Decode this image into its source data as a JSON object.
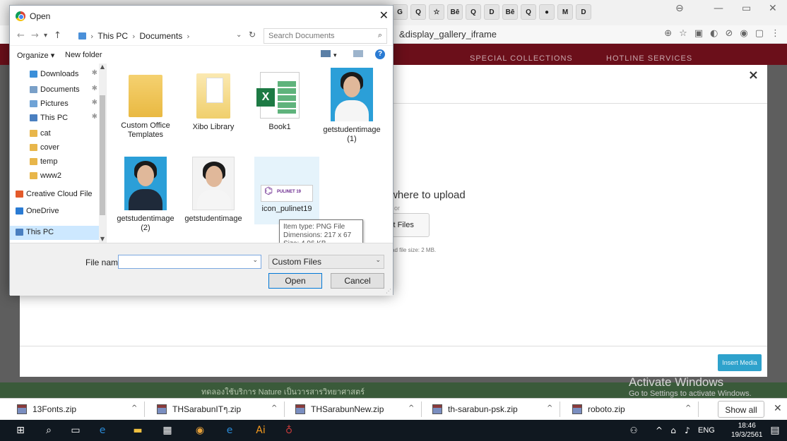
{
  "browser": {
    "address_text": "&display_gallery_iframe",
    "tabs": [
      "G",
      "Q",
      "☆",
      "Bē",
      "Q",
      "D",
      "Bē",
      "Q",
      "●",
      "M",
      "D"
    ],
    "site_nav": [
      "SPECIAL COLLECTIONS",
      "HOTLINE SERVICES"
    ]
  },
  "background_page": {
    "upload_title": "where to upload",
    "or_text": "or",
    "select_files_label": "ct Files",
    "max_size_text": "ad file size: 2 MB.",
    "insert_media_label": "Insert Media",
    "watermark_title": "Activate Windows",
    "watermark_sub": "Go to Settings to activate Windows.",
    "strip_text": "ทดลองใช้บริการ Nature เป็นวารสารวิทยาศาสตร์"
  },
  "dialog": {
    "title": "Open",
    "breadcrumb": [
      "This PC",
      "Documents"
    ],
    "search_placeholder": "Search Documents",
    "organize_label": "Organize ▾",
    "new_folder_label": "New folder",
    "sidebar": [
      {
        "label": "Downloads",
        "pinned": true,
        "color": "#3b8fd9"
      },
      {
        "label": "Documents",
        "pinned": true,
        "color": "#7aa0c8"
      },
      {
        "label": "Pictures",
        "pinned": true,
        "color": "#6fa3d6"
      },
      {
        "label": "This PC",
        "pinned": true,
        "color": "#4a7fc0"
      },
      {
        "label": "cat",
        "pinned": false,
        "color": "#e8b64a"
      },
      {
        "label": "cover",
        "pinned": false,
        "color": "#e8b64a"
      },
      {
        "label": "temp",
        "pinned": false,
        "color": "#e8b64a"
      },
      {
        "label": "www2",
        "pinned": false,
        "color": "#e8b64a"
      },
      {
        "label": "Creative Cloud File",
        "pinned": false,
        "color": "#e35a2a"
      },
      {
        "label": "OneDrive",
        "pinned": false,
        "color": "#2a7bd3"
      },
      {
        "label": "This PC",
        "pinned": false,
        "color": "#4a7fc0"
      }
    ],
    "files": [
      {
        "name": "Custom Office Templates",
        "kind": "folder"
      },
      {
        "name": "Xibo Library",
        "kind": "folder-lib"
      },
      {
        "name": "Book1",
        "kind": "excel"
      },
      {
        "name": "getstudentimage (1)",
        "kind": "photo-female"
      },
      {
        "name": "getstudentimage (2)",
        "kind": "photo-male"
      },
      {
        "name": "getstudentimage",
        "kind": "photo-female-light"
      },
      {
        "name": "icon_pulinet19",
        "kind": "logo"
      }
    ],
    "logo_thumb_text": "PULINET 19",
    "tooltip": {
      "type": "Item type: PNG File",
      "dimensions": "Dimensions: 217 x 67",
      "size": "Size: 4.96 KB"
    },
    "file_name_label": "File name:",
    "file_name_value": "",
    "filter_value": "Custom Files",
    "open_label": "Open",
    "cancel_label": "Cancel"
  },
  "downloads": [
    {
      "name": "13Fonts.zip"
    },
    {
      "name": "THSarabunITๆ.zip"
    },
    {
      "name": "THSarabunNew.zip"
    },
    {
      "name": "th-sarabun-psk.zip"
    },
    {
      "name": "roboto.zip"
    }
  ],
  "show_all_label": "Show all",
  "taskbar": {
    "lang": "ENG",
    "time": "18:46",
    "date": "19/3/2561"
  }
}
